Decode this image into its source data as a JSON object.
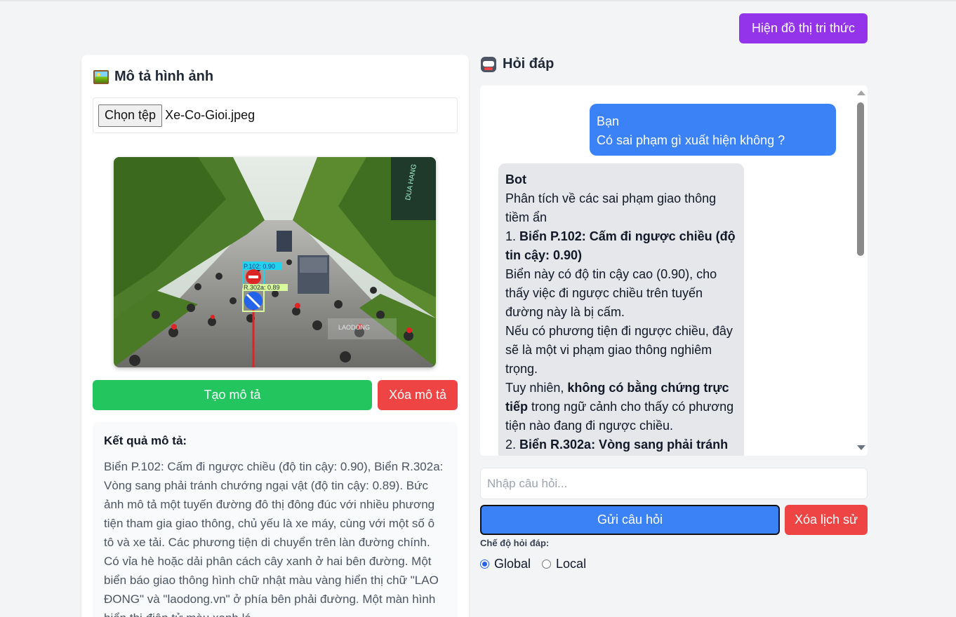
{
  "header": {
    "kg_button_label": "Hiện đồ thị tri thức"
  },
  "left": {
    "title": "Mô tả hình ảnh",
    "file_button_label": "Chọn tệp",
    "file_name": "Xe-Co-Gioi.jpeg",
    "image_overlay": {
      "detection1_label": "P.102: 0.90",
      "detection2_label": "R.302a: 0.89",
      "sign_text": "DUA HANG",
      "watermark": "LAODONG"
    },
    "generate_button_label": "Tạo mô tả",
    "clear_button_label": "Xóa mô tả",
    "result_title": "Kết quả mô tả:",
    "result_text": "Biển P.102: Cấm đi ngược chiều (độ tin cậy: 0.90), Biển R.302a: Vòng sang phải tránh chướng ngại vật (độ tin cậy: 0.89). Bức ảnh mô tả một tuyến đường đô thị đông đúc với nhiều phương tiện tham gia giao thông, chủ yếu là xe máy, cùng với một số ô tô và xe tải. Các phương tiện di chuyển trên làn đường chính. Có vỉa hè hoặc dải phân cách cây xanh ở hai bên đường. Một biển báo giao thông hình chữ nhật màu vàng hiển thị chữ \"LAO ĐONG\" và \"laodong.vn\" ở phía bên phải đường. Một màn hình hiển thị điện tử màu xanh lá"
  },
  "right": {
    "title": "Hỏi đáp",
    "user_msg": {
      "sender": "Bạn",
      "text": "Có sai phạm gì xuất hiện không ?"
    },
    "bot_msg": {
      "sender": "Bot",
      "intro": "Phân tích về các sai phạm giao thông tiềm ẩn",
      "item1_num": "1. ",
      "item1_title": "Biển P.102: Cấm đi ngược chiều (độ tin cậy: 0.90)",
      "item1_p1": "Biển này có độ tin cậy cao (0.90), cho thấy việc đi ngược chiều trên tuyến đường này là bị cấm.",
      "item1_p2": "Nếu có phương tiện đi ngược chiều, đây sẽ là một vi phạm giao thông nghiêm trọng.",
      "item1_p3_a": "Tuy nhiên, ",
      "item1_p3_bold": "không có bằng chứng trực tiếp",
      "item1_p3_b": " trong ngữ cảnh cho thấy có phương tiện nào đang đi ngược chiều.",
      "item2_num": "2. ",
      "item2_title": "Biển R.302a: Vòng sang phải tránh"
    },
    "input_placeholder": "Nhập câu hỏi...",
    "send_button_label": "Gửi câu hỏi",
    "clear_history_label": "Xóa lịch sử",
    "mode_label": "Chế độ hỏi đáp:",
    "mode_options": [
      "Global",
      "Local"
    ],
    "mode_selected": "Global"
  },
  "colors": {
    "purple": "#9333ea",
    "green": "#22c55e",
    "red": "#ef4444",
    "blue": "#3b82f6"
  }
}
